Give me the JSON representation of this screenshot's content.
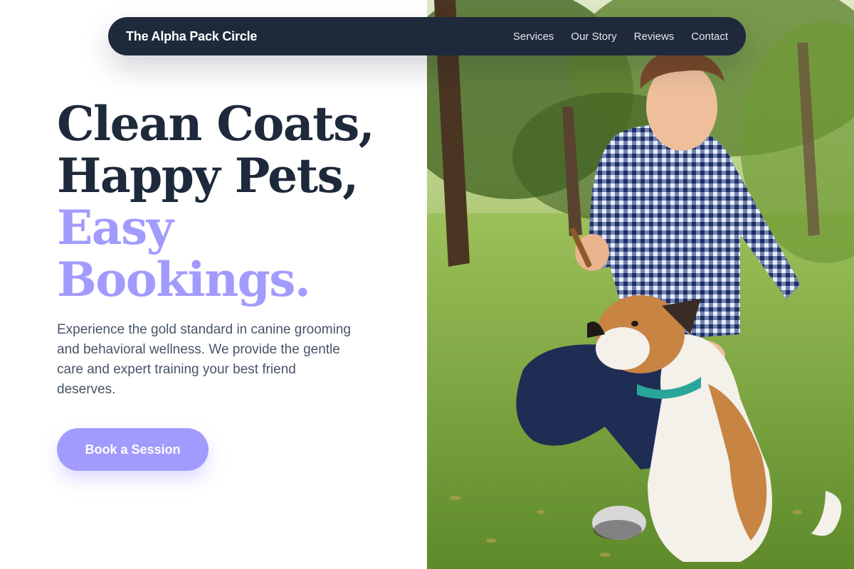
{
  "nav": {
    "brand": "The Alpha Pack Circle",
    "links": [
      "Services",
      "Our Story",
      "Reviews",
      "Contact"
    ]
  },
  "hero": {
    "headline_lines": [
      "Clean Coats,",
      "Happy Pets,"
    ],
    "headline_accent_lines": [
      "Easy",
      "Bookings."
    ],
    "description": "Experience the gold standard in canine grooming and behavioral wellness. We provide the gentle care and expert training your best friend deserves.",
    "cta_label": "Book a Session",
    "image_icon": "photo-man-with-dog-in-park"
  },
  "colors": {
    "navy": "#1e293b",
    "accent": "#a29bfe",
    "body_text": "#475569",
    "background": "#ffffff"
  }
}
